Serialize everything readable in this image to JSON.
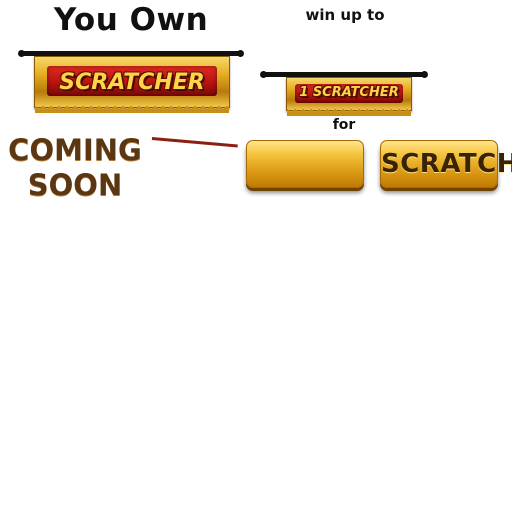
{
  "heading": "You Own",
  "owned_banner": {
    "label": "SCRATCHER"
  },
  "prize": {
    "win_label": "win up to",
    "banner_label": "1 SCRATCHER",
    "for_label": "for"
  },
  "status": {
    "line1": "COMING",
    "line2": "SOON"
  },
  "buttons": {
    "price_label": "",
    "scratch_label": "SCRATCH"
  },
  "colors": {
    "gold": "#e7ac20",
    "red": "#b8140f",
    "coming_soon": "#5a3612"
  }
}
